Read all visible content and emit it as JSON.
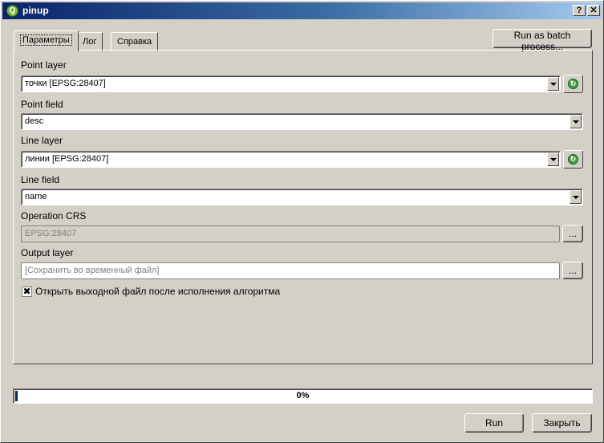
{
  "window": {
    "title": "pinup",
    "icon": "qgis-icon",
    "help_label": "?",
    "close_label": "✕"
  },
  "tabs": [
    {
      "label": "Параметры",
      "active": true
    },
    {
      "label": "Лог",
      "active": false
    },
    {
      "label": "Справка",
      "active": false
    }
  ],
  "batch_button": "Run as batch process...",
  "fields": {
    "point_layer": {
      "label": "Point layer",
      "value": "точки [EPSG:28407]"
    },
    "point_field": {
      "label": "Point field",
      "value": "desc"
    },
    "line_layer": {
      "label": "Line layer",
      "value": "линии [EPSG:28407]"
    },
    "line_field": {
      "label": "Line field",
      "value": "name"
    },
    "operation_crs": {
      "label": "Operation CRS",
      "value": "EPSG:28407",
      "button": "..."
    },
    "output_layer": {
      "label": "Output layer",
      "placeholder": "[Сохранить во временный файл]",
      "button": "..."
    }
  },
  "open_output": {
    "label": "Открыть выходной файл после исполнения алгоритма",
    "checked": true,
    "mark": "✖"
  },
  "progress": {
    "value": 0,
    "text": "0%"
  },
  "buttons": {
    "run": "Run",
    "close": "Закрыть"
  },
  "colors": {
    "title_start": "#0a246a",
    "title_end": "#a6caf0",
    "dialog_bg": "#d4d0c8",
    "iterate_icon": "#43a047"
  }
}
